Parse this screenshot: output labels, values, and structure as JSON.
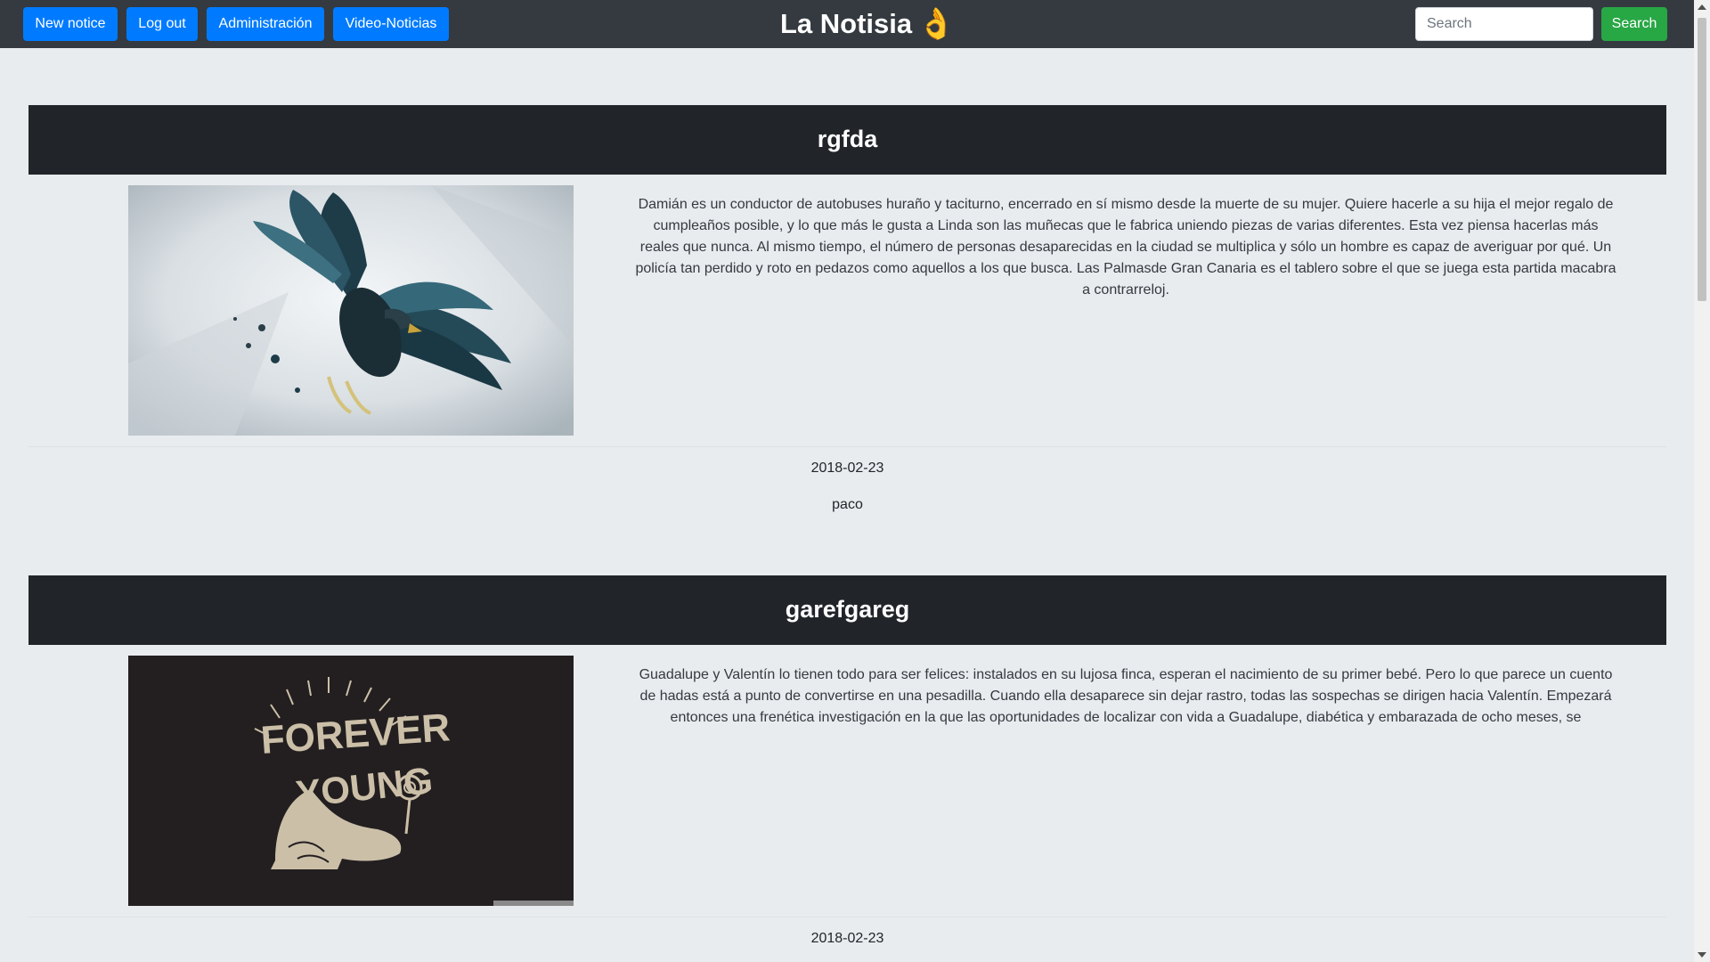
{
  "navbar": {
    "buttons": [
      {
        "label": "New notice"
      },
      {
        "label": "Log out"
      },
      {
        "label": "Administración"
      },
      {
        "label": "Video-Noticias"
      }
    ],
    "brand": "La Notisia",
    "brand_icon": "ok-hand-icon",
    "search_placeholder": "Search",
    "search_value": "",
    "search_button": "Search"
  },
  "articles": [
    {
      "title": "rgfda",
      "image": "eagle-illustration",
      "body": "Damián es un conductor de autobuses huraño y taciturno, encerrado en sí mismo desde la muerte de su mujer. Quiere hacerle a su hija el mejor regalo de cumpleaños posible, y lo que más le gusta a Linda son las muñecas que le fabrica uniendo piezas de varias diferentes. Esta vez piensa hacerlas más reales que nunca. Al mismo tiempo, el número de personas desaparecidas en la ciudad se multiplica y sólo un hombre es capaz de averiguar por qué. Un policía tan perdido y roto en pedazos como aquellos a los que busca. Las Palmasde Gran Canaria es el tablero sobre el que se juega esta partida macabra a contrarreloj.",
      "date": "2018-02-23",
      "author": "paco"
    },
    {
      "title": "garefgareg",
      "image": "forever-young-illustration",
      "image_lettering": [
        "FOREVER",
        "YOUNG"
      ],
      "body": "Guadalupe y Valentín lo tienen todo para ser felices: instalados en su lujosa finca, esperan el nacimiento de su primer bebé. Pero lo que parece un cuento de hadas está a punto de convertirse en una pesadilla. Cuando ella desaparece sin dejar rastro, todas las sospechas se dirigen hacia Valentín. Empezará entonces una frenética investigación en la que las oportunidades de localizar con vida a Guadalupe, diabética y embarazada de ocho meses, se",
      "date": "2018-02-23"
    }
  ],
  "colors": {
    "navbar": "#343a40",
    "primary": "#007bff",
    "success": "#28a745",
    "header_dark": "#212529",
    "page_bg": "#e9ecef"
  }
}
